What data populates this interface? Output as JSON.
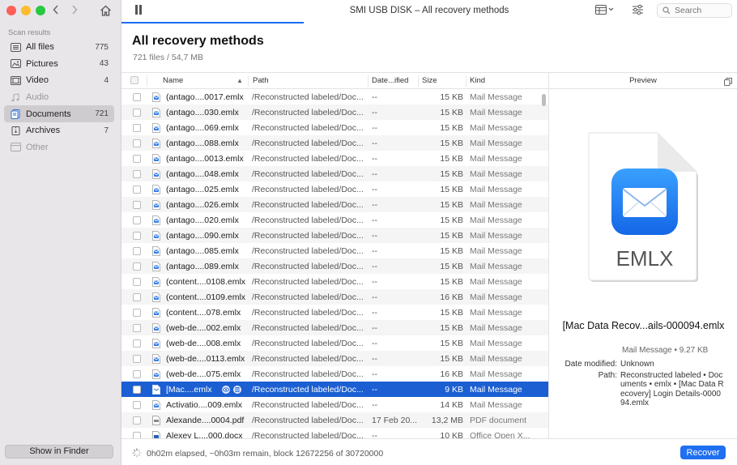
{
  "window": {
    "title": "SMI USB DISK – All recovery methods"
  },
  "search": {
    "placeholder": "Search"
  },
  "sidebar": {
    "section_title": "Scan results",
    "items": [
      {
        "label": "All files",
        "count": "775",
        "icon": "all-files-icon"
      },
      {
        "label": "Pictures",
        "count": "43",
        "icon": "pictures-icon"
      },
      {
        "label": "Video",
        "count": "4",
        "icon": "video-icon"
      },
      {
        "label": "Audio",
        "count": "",
        "icon": "audio-icon"
      },
      {
        "label": "Documents",
        "count": "721",
        "icon": "documents-icon"
      },
      {
        "label": "Archives",
        "count": "7",
        "icon": "archives-icon"
      },
      {
        "label": "Other",
        "count": "",
        "icon": "other-icon"
      }
    ],
    "show_in_finder": "Show in Finder"
  },
  "header": {
    "title": "All recovery methods",
    "subtitle": "721 files / 54,7 MB"
  },
  "table": {
    "columns": {
      "name": "Name",
      "path": "Path",
      "date": "Date...ified",
      "size": "Size",
      "kind": "Kind"
    },
    "rows": [
      {
        "name": "(antago....0017.emlx",
        "path": "/Reconstructed labeled/Doc...",
        "date": "--",
        "size": "15 KB",
        "kind": "Mail Message"
      },
      {
        "name": "(antago....030.emlx",
        "path": "/Reconstructed labeled/Doc...",
        "date": "--",
        "size": "15 KB",
        "kind": "Mail Message"
      },
      {
        "name": "(antago....069.emlx",
        "path": "/Reconstructed labeled/Doc...",
        "date": "--",
        "size": "15 KB",
        "kind": "Mail Message"
      },
      {
        "name": "(antago....088.emlx",
        "path": "/Reconstructed labeled/Doc...",
        "date": "--",
        "size": "15 KB",
        "kind": "Mail Message"
      },
      {
        "name": "(antago....0013.emlx",
        "path": "/Reconstructed labeled/Doc...",
        "date": "--",
        "size": "15 KB",
        "kind": "Mail Message"
      },
      {
        "name": "(antago....048.emlx",
        "path": "/Reconstructed labeled/Doc...",
        "date": "--",
        "size": "15 KB",
        "kind": "Mail Message"
      },
      {
        "name": "(antago....025.emlx",
        "path": "/Reconstructed labeled/Doc...",
        "date": "--",
        "size": "15 KB",
        "kind": "Mail Message"
      },
      {
        "name": "(antago....026.emlx",
        "path": "/Reconstructed labeled/Doc...",
        "date": "--",
        "size": "15 KB",
        "kind": "Mail Message"
      },
      {
        "name": "(antago....020.emlx",
        "path": "/Reconstructed labeled/Doc...",
        "date": "--",
        "size": "15 KB",
        "kind": "Mail Message"
      },
      {
        "name": "(antago....090.emlx",
        "path": "/Reconstructed labeled/Doc...",
        "date": "--",
        "size": "15 KB",
        "kind": "Mail Message"
      },
      {
        "name": "(antago....085.emlx",
        "path": "/Reconstructed labeled/Doc...",
        "date": "--",
        "size": "15 KB",
        "kind": "Mail Message"
      },
      {
        "name": "(antago....089.emlx",
        "path": "/Reconstructed labeled/Doc...",
        "date": "--",
        "size": "15 KB",
        "kind": "Mail Message"
      },
      {
        "name": "(content....0108.emlx",
        "path": "/Reconstructed labeled/Doc...",
        "date": "--",
        "size": "15 KB",
        "kind": "Mail Message"
      },
      {
        "name": "(content....0109.emlx",
        "path": "/Reconstructed labeled/Doc...",
        "date": "--",
        "size": "16 KB",
        "kind": "Mail Message"
      },
      {
        "name": "(content....078.emlx",
        "path": "/Reconstructed labeled/Doc...",
        "date": "--",
        "size": "15 KB",
        "kind": "Mail Message"
      },
      {
        "name": "(web-de....002.emlx",
        "path": "/Reconstructed labeled/Doc...",
        "date": "--",
        "size": "15 KB",
        "kind": "Mail Message"
      },
      {
        "name": "(web-de....008.emlx",
        "path": "/Reconstructed labeled/Doc...",
        "date": "--",
        "size": "15 KB",
        "kind": "Mail Message"
      },
      {
        "name": "(web-de....0113.emlx",
        "path": "/Reconstructed labeled/Doc...",
        "date": "--",
        "size": "15 KB",
        "kind": "Mail Message"
      },
      {
        "name": "(web-de....075.emlx",
        "path": "/Reconstructed labeled/Doc...",
        "date": "--",
        "size": "16 KB",
        "kind": "Mail Message"
      },
      {
        "name": "[Mac....emlx",
        "path": "/Reconstructed labeled/Doc...",
        "date": "--",
        "size": "9 KB",
        "kind": "Mail Message",
        "selected": true
      },
      {
        "name": "Activatio....009.emlx",
        "path": "/Reconstructed labeled/Doc...",
        "date": "--",
        "size": "14 KB",
        "kind": "Mail Message"
      },
      {
        "name": "Alexande....0004.pdf",
        "path": "/Reconstructed labeled/Doc...",
        "date": "17 Feb 20...",
        "size": "13,2 MB",
        "kind": "PDF document"
      },
      {
        "name": "Alexey L....000.docx",
        "path": "/Reconstructed labeled/Doc...",
        "date": "--",
        "size": "10 KB",
        "kind": "Office Open X..."
      }
    ]
  },
  "preview": {
    "header": "Preview",
    "icon_label": "EMLX",
    "file_name": "[Mac Data Recov...ails-000094.emlx",
    "kind_size": "Mail Message • 9.27 KB",
    "meta": [
      {
        "key": "Date modified:",
        "value": "Unknown"
      },
      {
        "key": "Path:",
        "value": "Reconstructed labeled • Documents • emlx • [Mac Data Recovery] Login Details-000094.emlx"
      }
    ]
  },
  "status": {
    "text": "0h02m elapsed, ~0h03m remain, block 12672256 of 30720000",
    "recover": "Recover"
  },
  "colors": {
    "accent": "#1f6ff0",
    "selection": "#1b5fd2"
  }
}
